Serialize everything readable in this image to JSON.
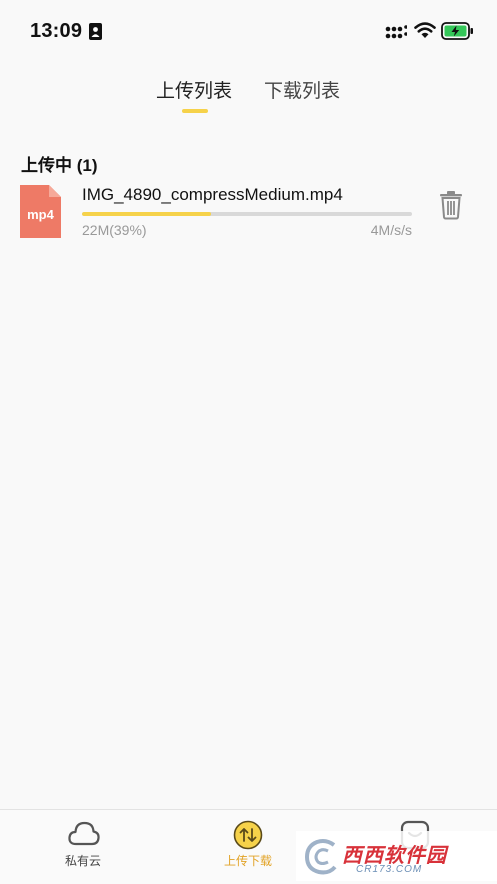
{
  "status_bar": {
    "time": "13:09"
  },
  "tabs": [
    {
      "label": "上传列表",
      "active": true
    },
    {
      "label": "下载列表",
      "active": false
    }
  ],
  "section": {
    "title": "上传中 (1)"
  },
  "upload_item": {
    "file_type": "mp4",
    "file_name": "IMG_4890_compressMedium.mp4",
    "progress": 0.39,
    "size_text": "22M(39%)",
    "speed_text": "4M/s/s"
  },
  "bottom_nav": [
    {
      "label": "私有云",
      "icon": "cloud-icon",
      "active": false
    },
    {
      "label": "上传下载",
      "icon": "transfer-icon",
      "active": true
    },
    {
      "label": "",
      "icon": "smiley-box-icon",
      "active": false
    }
  ],
  "watermark": {
    "text": "西西软件园",
    "sub": "CR173.COM"
  },
  "colors": {
    "accent": "#f6d24a",
    "active_nav": "#e2a326",
    "file_icon": "#ee7a66",
    "text_secondary": "#999999"
  }
}
